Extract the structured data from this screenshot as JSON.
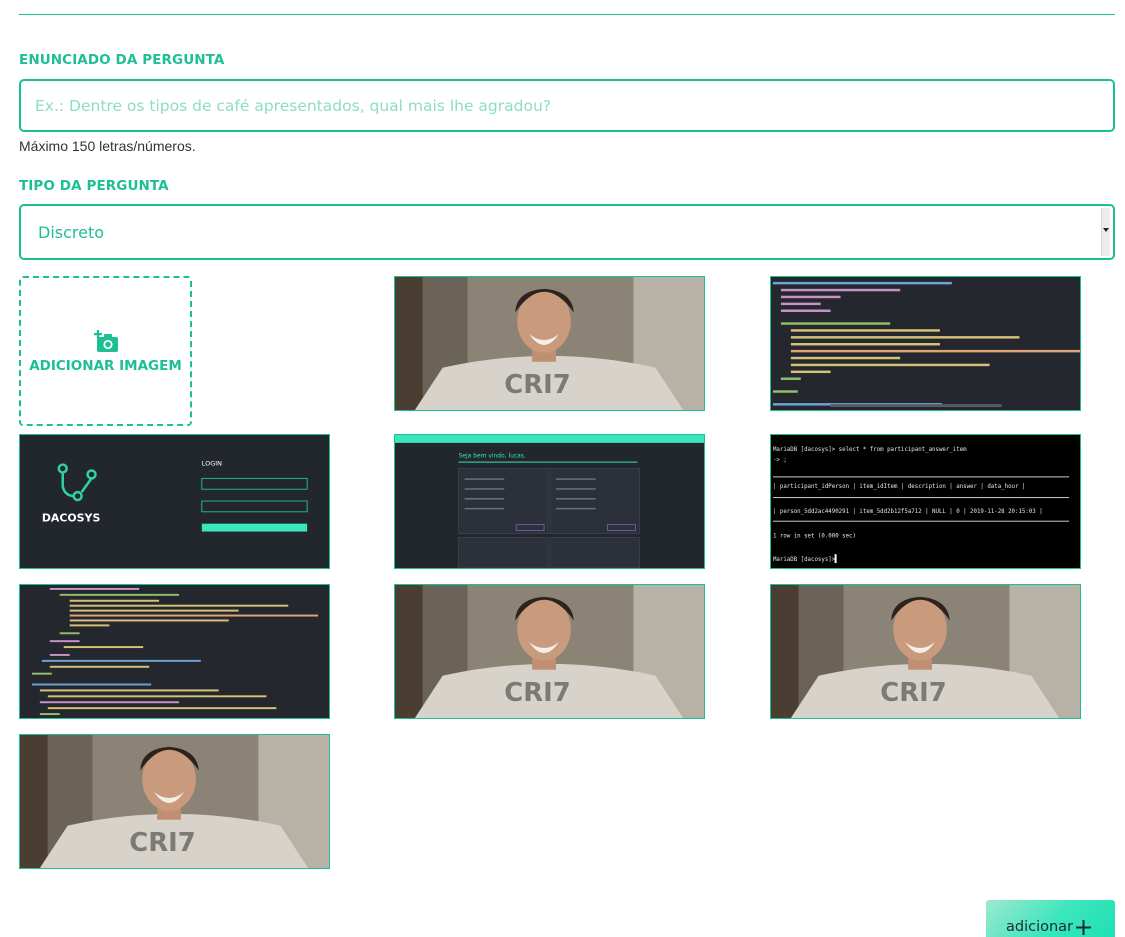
{
  "question": {
    "label": "ENUNCIADO DA PERGUNTA",
    "value": "",
    "placeholder": "Ex.: Dentre os tipos de café apresentados, qual mais lhe agradou?",
    "help": "Máximo 150 letras/números."
  },
  "question_type": {
    "label": "TIPO DA PERGUNTA",
    "selected": "Discreto"
  },
  "images": {
    "add_label": "ADICIONAR IMAGEM",
    "add_icon": "camera-plus-icon",
    "thumbnails": [
      {
        "kind": "portrait-photo"
      },
      {
        "kind": "code-screenshot"
      },
      {
        "kind": "login-screen"
      },
      {
        "kind": "dashboard-screenshot"
      },
      {
        "kind": "terminal-screenshot"
      },
      {
        "kind": "code-screenshot"
      },
      {
        "kind": "portrait-photo"
      },
      {
        "kind": "portrait-photo"
      },
      {
        "kind": "portrait-photo"
      }
    ],
    "login_thumb": {
      "brand": "DACOSYS",
      "title": "LOGIN"
    },
    "dashboard_thumb": {
      "greeting": "Seja bem vindo, lucas."
    },
    "terminal_thumb": {
      "line1": "MariaDB [dacosys]> select * from participant_answer_item",
      "line2": "    -> ;",
      "header": "| participant_idPerson | item_idItem       | description | answer | data_hour           |",
      "row": "| person_5dd2ac4490291 | item_5dd2b12f5a712 | NULL        |      0 | 2019-11-28 20:15:03 |",
      "footer": "1 row in set (0.000 sec)",
      "prompt": "MariaDB [dacosys]> "
    }
  },
  "submit": {
    "label": "adicionar",
    "icon": "plus-icon"
  },
  "colors": {
    "accent": "#1dbf95",
    "button_gradient_end": "#1fe0b4"
  }
}
